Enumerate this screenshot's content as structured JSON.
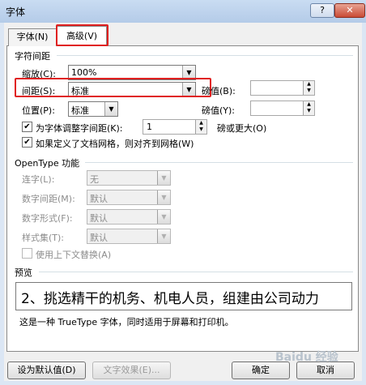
{
  "window": {
    "title": "字体",
    "help_label": "?",
    "close_label": "✕"
  },
  "tabs": [
    {
      "label": "字体(N)"
    },
    {
      "label": "高级(V)"
    }
  ],
  "spacing": {
    "group": "字符间距",
    "scale_label": "缩放(C):",
    "scale_value": "100%",
    "spacing_label": "间距(S):",
    "spacing_value": "标准",
    "position_label": "位置(P):",
    "position_value": "标准",
    "by1_label": "磅值(B):",
    "by2_label": "磅值(Y):",
    "kern_label": "为字体调整字间距(K):",
    "kern_value": "1",
    "kern_suffix": "磅或更大(O)",
    "grid_label": "如果定义了文档网格，则对齐到网格(W)"
  },
  "opentype": {
    "group": "OpenType 功能",
    "ligature_label": "连字(L):",
    "ligature_value": "无",
    "numspace_label": "数字间距(M):",
    "numspace_value": "默认",
    "numform_label": "数字形式(F):",
    "numform_value": "默认",
    "styleset_label": "样式集(T):",
    "styleset_value": "默认",
    "context_label": "使用上下文替换(A)"
  },
  "preview": {
    "group": "预览",
    "text": "2、挑选精干的机务、机电人员，组建由公司动力",
    "note": "这是一种 TrueType 字体，同时适用于屏幕和打印机。"
  },
  "buttons": {
    "default": "设为默认值(D)",
    "effects": "文字效果(E)...",
    "ok": "确定",
    "cancel": "取消"
  },
  "watermark": "Baidu 经验"
}
